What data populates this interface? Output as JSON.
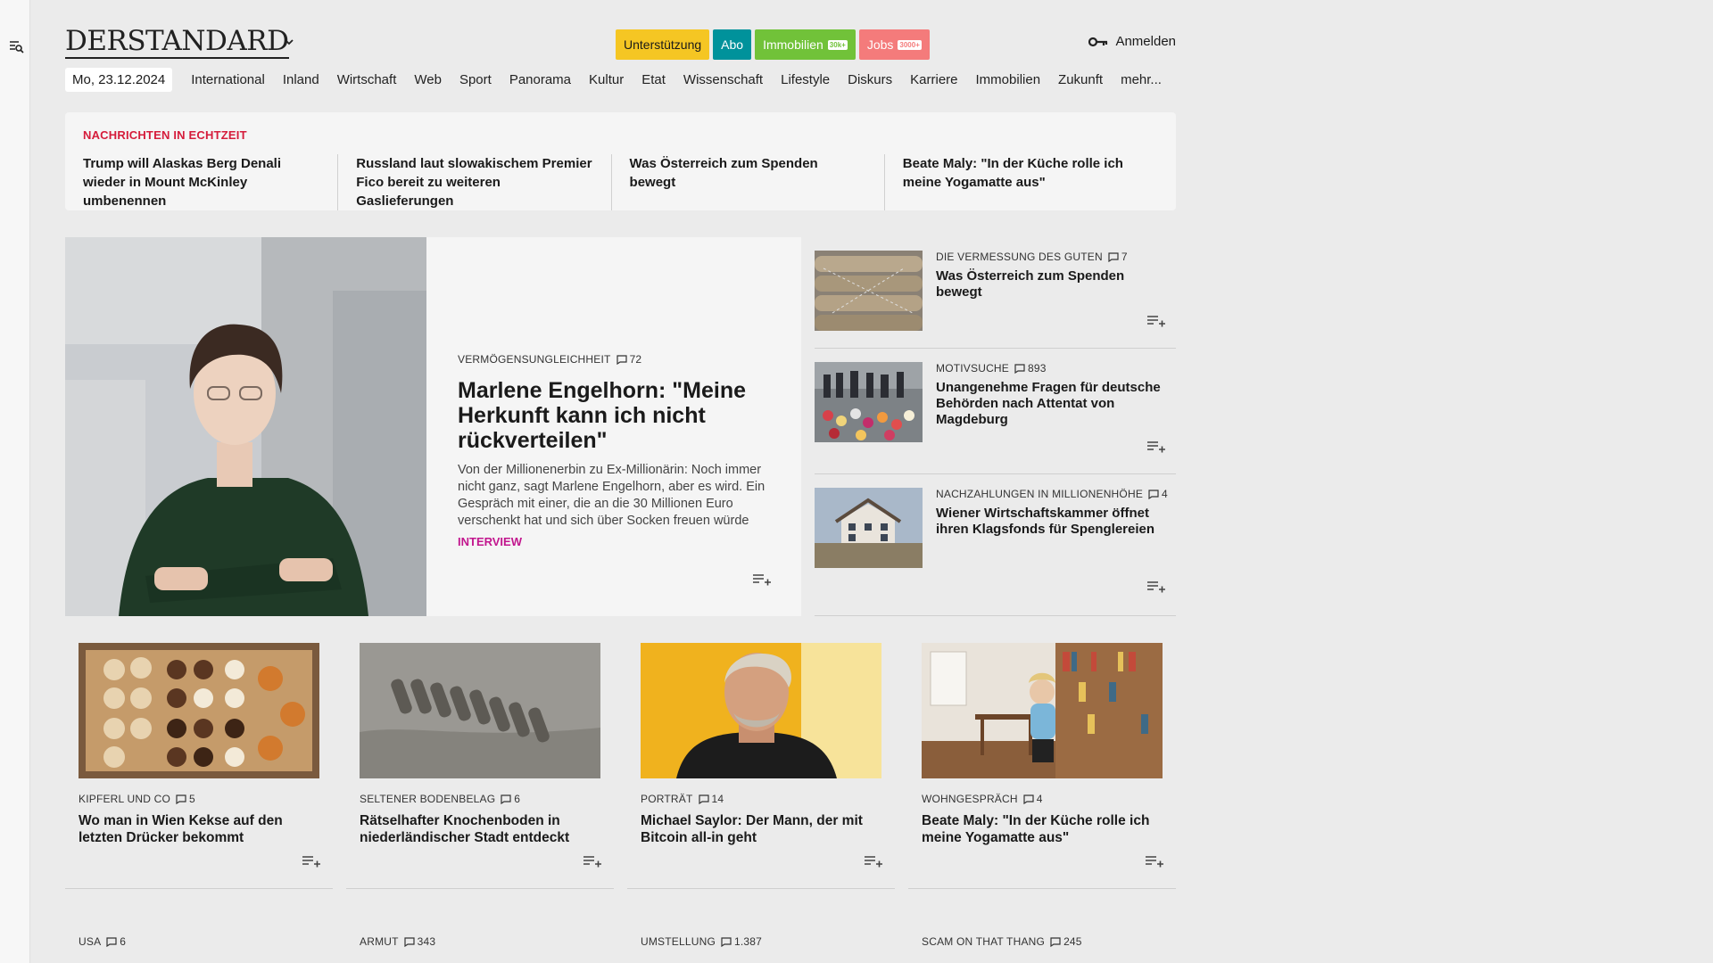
{
  "brand": {
    "logo": "DERSTANDARD"
  },
  "header": {
    "pills": [
      {
        "label": "Unterstützung",
        "bg": "#f5c623",
        "fg": "#1a1a1a",
        "badge": ""
      },
      {
        "label": "Abo",
        "bg": "#00929b",
        "fg": "#ffffff",
        "badge": ""
      },
      {
        "label": "Immobilien",
        "bg": "#71c239",
        "fg": "#ffffff",
        "badge": "30k+"
      },
      {
        "label": "Jobs",
        "bg": "#f47b7b",
        "fg": "#ffffff",
        "badge": "3000+"
      }
    ],
    "login": "Anmelden"
  },
  "nav": {
    "date": "Mo, 23.12.2024",
    "items": [
      "International",
      "Inland",
      "Wirtschaft",
      "Web",
      "Sport",
      "Panorama",
      "Kultur",
      "Etat",
      "Wissenschaft",
      "Lifestyle",
      "Diskurs",
      "Karriere",
      "Immobilien",
      "Zukunft",
      "mehr..."
    ]
  },
  "ticker": {
    "title": "NACHRICHTEN IN ECHTZEIT",
    "items": [
      "Trump will Alaskas Berg Denali wieder in Mount McKinley umbenennen",
      "Russland laut slowakischem Premier Fico bereit zu weiteren Gaslieferungen",
      "Was Österreich zum Spenden bewegt",
      "Beate Maly: \"In der Küche rolle ich meine Yogamatte aus\""
    ]
  },
  "hero": {
    "kicker": "VERMÖGENSUNGLEICHHEIT",
    "comments": "72",
    "title": "Marlene Engelhorn: \"Meine Herkunft kann ich nicht rückverteilen\"",
    "text": "Von der Millionenerbin zu Ex-Millionärin: Noch immer nicht ganz, sagt Marlene Engelhorn, aber es wird. Ein Gespräch mit einer, die an die 30 Millionen Euro verschenkt hat und sich über Socken freuen würde",
    "tag": "INTERVIEW"
  },
  "side": [
    {
      "kicker": "DIE VERMESSUNG DES GUTEN",
      "comments": "7",
      "title": "Was Österreich zum Spenden bewegt"
    },
    {
      "kicker": "MOTIVSUCHE",
      "comments": "893",
      "title": "Unangenehme Fragen für deutsche Behörden nach Attentat von Magdeburg"
    },
    {
      "kicker": "NACHZAHLUNGEN IN MILLIONENHÖHE",
      "comments": "4",
      "title": "Wiener Wirtschaftskammer öffnet ihren Klagsfonds für Spenglereien"
    }
  ],
  "cards": [
    {
      "kicker": "KIPFERL UND CO",
      "comments": "5",
      "title": "Wo man in Wien Kekse auf den letzten Drücker bekommt"
    },
    {
      "kicker": "SELTENER BODENBELAG",
      "comments": "6",
      "title": "Rätselhafter Knochenboden in niederländischer Stadt entdeckt"
    },
    {
      "kicker": "PORTRÄT",
      "comments": "14",
      "title": "Michael Saylor: Der Mann, der mit Bitcoin all-in geht"
    },
    {
      "kicker": "WOHNGESPRÄCH",
      "comments": "4",
      "title": "Beate Maly: \"In der Küche rolle ich meine Yogamatte aus\""
    }
  ],
  "row3": [
    {
      "kicker": "USA",
      "comments": "6"
    },
    {
      "kicker": "ARMUT",
      "comments": "343"
    },
    {
      "kicker": "UMSTELLUNG",
      "comments": "1.387"
    },
    {
      "kicker": "SCAM ON THAT THANG",
      "comments": "245"
    }
  ]
}
